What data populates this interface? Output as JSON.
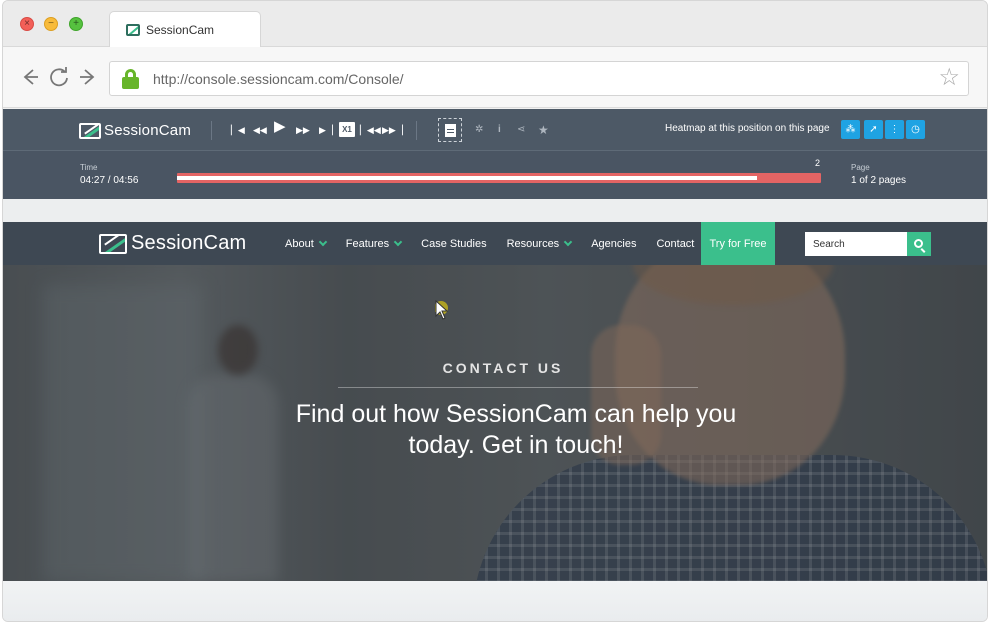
{
  "browser": {
    "tab_title": "SessionCam",
    "url": "http://console.sessioncam.com/Console/"
  },
  "player": {
    "brand": "SessionCam",
    "speed": "X1",
    "heatmap_label": "Heatmap at this position on this page",
    "time_label": "Time",
    "time_value": "04:27 / 04:56",
    "progress_fraction": 0.9,
    "timeline_marker": "2",
    "page_label": "Page",
    "page_value": "1 of 2 pages"
  },
  "site": {
    "brand": "SessionCam",
    "menu": [
      {
        "label": "About",
        "dropdown": true
      },
      {
        "label": "Features",
        "dropdown": true
      },
      {
        "label": "Case Studies",
        "dropdown": false
      },
      {
        "label": "Resources",
        "dropdown": true
      },
      {
        "label": "Agencies",
        "dropdown": false
      },
      {
        "label": "Contact",
        "dropdown": false
      }
    ],
    "cta": "Try for Free",
    "search_placeholder": "Search",
    "hero_kicker": "CONTACT US",
    "hero_line1": "Find out how SessionCam can help you",
    "hero_line2": "today. Get in touch!"
  },
  "colors": {
    "accent": "#3bbf8c",
    "player_bg": "#4d5966",
    "timeline": "#e46464",
    "heatmap_buttons": "#1fa3e3"
  },
  "icons": [
    "close-icon",
    "minimize-icon",
    "maximize-icon",
    "back-arrow-icon",
    "reload-icon",
    "forward-arrow-icon",
    "lock-icon",
    "bookmark-star-icon",
    "skip-start-icon",
    "rewind-icon",
    "play-icon",
    "fast-forward-icon",
    "skip-end-icon",
    "previous-page-icon",
    "next-page-icon",
    "document-icon",
    "settings-icon",
    "info-icon",
    "share-icon",
    "favorite-star-icon",
    "heatmap-click-icon",
    "heatmap-pointer-icon",
    "heatmap-scroll-icon",
    "heatmap-time-icon",
    "search-icon",
    "mouse-cursor-icon"
  ]
}
